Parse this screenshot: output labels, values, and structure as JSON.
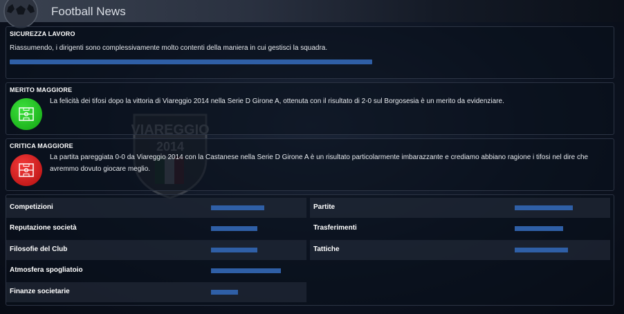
{
  "app": {
    "title": "Football News"
  },
  "watermark": {
    "club_text": "VIAREGGIO",
    "year_text": "2014"
  },
  "job_security": {
    "heading": "SICUREZZA LAVORO",
    "text": "Riassumendo, i dirigenti sono complessivamente molto contenti della maniera in cui gestisci la squadra.",
    "level": 0.6
  },
  "highest_merit": {
    "heading": "MERITO MAGGIORE",
    "icon": "pitch-icon",
    "color": "#22c222",
    "text": "La felicità dei tifosi dopo la vittoria di Viareggio 2014 nella Serie D Girone A, ottenuta con il risultato di 2-0 sul Borgosesia è un merito da evidenziare."
  },
  "highest_criticism": {
    "heading": "CRITICA MAGGIORE",
    "icon": "pitch-icon",
    "color": "#d41a1a",
    "text": "La partita pareggiata 0-0 da Viareggio 2014 con la Castanese nella Serie D Girone A è un risultato particolarmente imbarazzante e crediamo abbiano ragione i tifosi nel dire che avremmo dovuto giocare meglio."
  },
  "ratings_left": [
    {
      "label": "Competizioni",
      "level": 0.55
    },
    {
      "label": "Reputazione società",
      "level": 0.48
    },
    {
      "label": "Filosofie del Club",
      "level": 0.48
    },
    {
      "label": "Atmosfera spogliatoio",
      "level": 0.72
    },
    {
      "label": "Finanze societarie",
      "level": 0.28
    }
  ],
  "ratings_right": [
    {
      "label": "Partite",
      "level": 0.6
    },
    {
      "label": "Trasferimenti",
      "level": 0.5
    },
    {
      "label": "Tattiche",
      "level": 0.55
    }
  ],
  "accent_color": "#2f5fa6"
}
